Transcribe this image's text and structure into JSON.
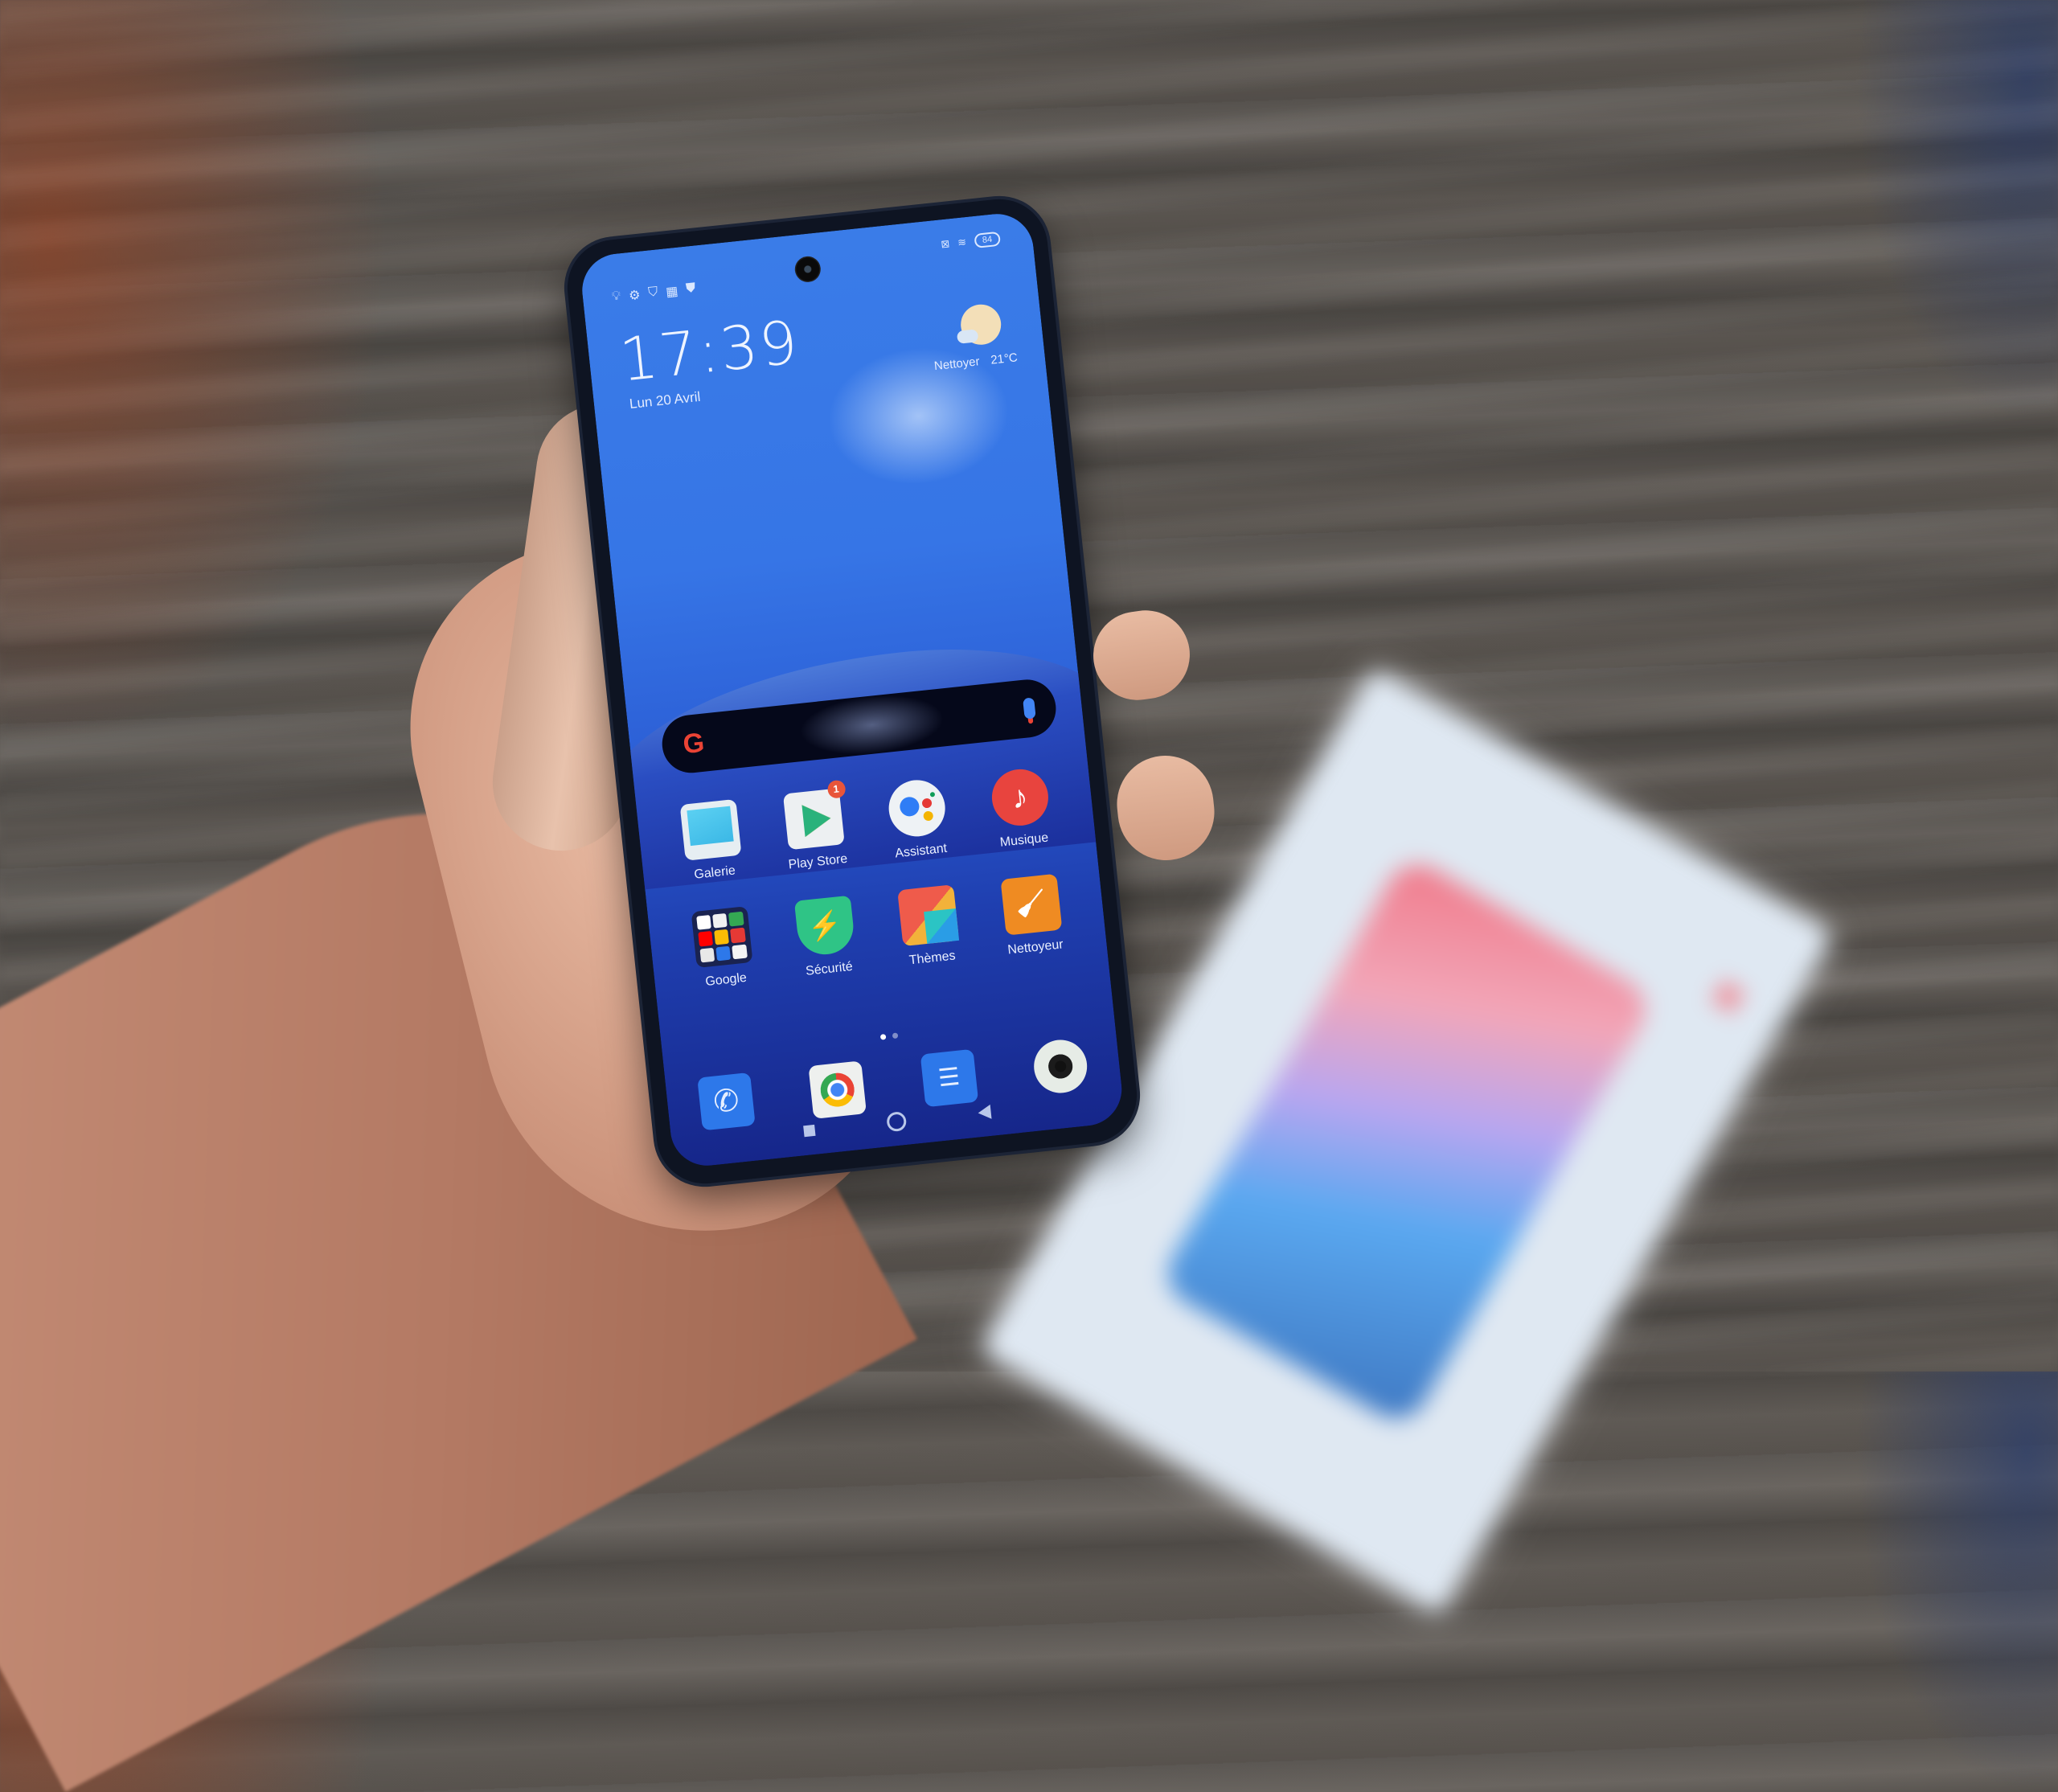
{
  "scene": {
    "description": "Hand holding a smartphone showing an Android (MIUI) home screen over a wooden table, retail box blurred in background",
    "colors": {
      "wallpaper_top": "#3a7ce8",
      "wallpaper_bottom": "#16268a",
      "table": "#5a5550",
      "box": "#dfe8f2"
    }
  },
  "status_bar": {
    "left_icons": [
      "lightbulb-icon",
      "gear-icon",
      "shield-play-icon",
      "app-grid-icon",
      "shield-badge-icon"
    ],
    "right_icons": [
      "sim-off-icon",
      "wifi-icon"
    ],
    "battery_level": "84"
  },
  "lock_widget": {
    "time": "17:39",
    "date": "Lun 20 Avril",
    "weather_label": "Nettoyer",
    "temperature": "21°C"
  },
  "search_bar": {
    "logo": "G",
    "mic": "mic-icon"
  },
  "apps": [
    {
      "label": "Galerie",
      "icon": "gallery-icon"
    },
    {
      "label": "Play Store",
      "icon": "play-store-icon",
      "badge": "1"
    },
    {
      "label": "Assistant",
      "icon": "assistant-icon"
    },
    {
      "label": "Musique",
      "icon": "music-icon"
    },
    {
      "label": "Google",
      "icon": "google-folder-icon"
    },
    {
      "label": "Sécurité",
      "icon": "security-icon"
    },
    {
      "label": "Thèmes",
      "icon": "themes-icon"
    },
    {
      "label": "Nettoyeur",
      "icon": "cleaner-icon"
    }
  ],
  "page_indicator": {
    "pages": 2,
    "current": 1
  },
  "dock": [
    {
      "icon": "phone-icon"
    },
    {
      "icon": "chrome-icon"
    },
    {
      "icon": "messages-icon"
    },
    {
      "icon": "camera-icon"
    }
  ],
  "nav_bar": [
    "recents-button",
    "home-button",
    "back-button"
  ]
}
